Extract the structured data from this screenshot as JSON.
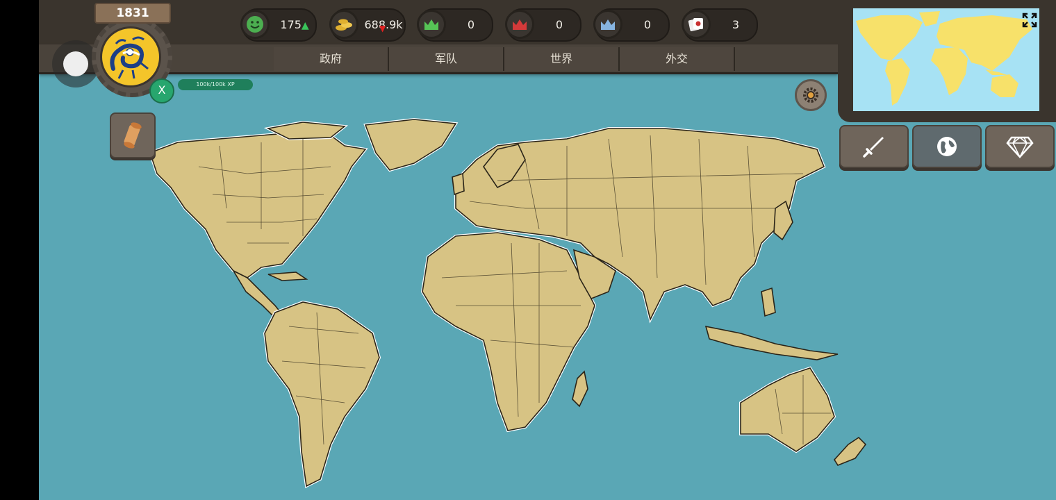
{
  "year": "1831",
  "player": {
    "badge_letter": "X",
    "xp_text": "100k/100k XP"
  },
  "resources": [
    {
      "name": "happiness",
      "icon": "smiley-icon",
      "value": "175",
      "trend": "up",
      "color": "#4caf50"
    },
    {
      "name": "gold",
      "icon": "coins-icon",
      "value": "688.9k",
      "trend": "down",
      "color": "#e0b030"
    },
    {
      "name": "green-crown",
      "icon": "green-crown-icon",
      "value": "0",
      "color": "#56c456"
    },
    {
      "name": "red-crown",
      "icon": "red-crown-icon",
      "value": "0",
      "color": "#d43a3a"
    },
    {
      "name": "blue-crown",
      "icon": "blue-crown-icon",
      "value": "0",
      "color": "#86b4e0"
    },
    {
      "name": "cards",
      "icon": "cards-icon",
      "value": "3",
      "color": "#c83030"
    }
  ],
  "tabs": [
    "政府",
    "军队",
    "世界",
    "外交"
  ],
  "side_buttons": [
    {
      "name": "war",
      "icon": "sword-icon"
    },
    {
      "name": "world",
      "icon": "globe-icon"
    },
    {
      "name": "premium",
      "icon": "diamond-icon"
    }
  ],
  "colors": {
    "ocean": "#5aa7b5",
    "land": "#d7c384",
    "panel": "#3a342d",
    "minimap_land": "#f7e16a",
    "minimap_sea": "#a7e2f4"
  }
}
